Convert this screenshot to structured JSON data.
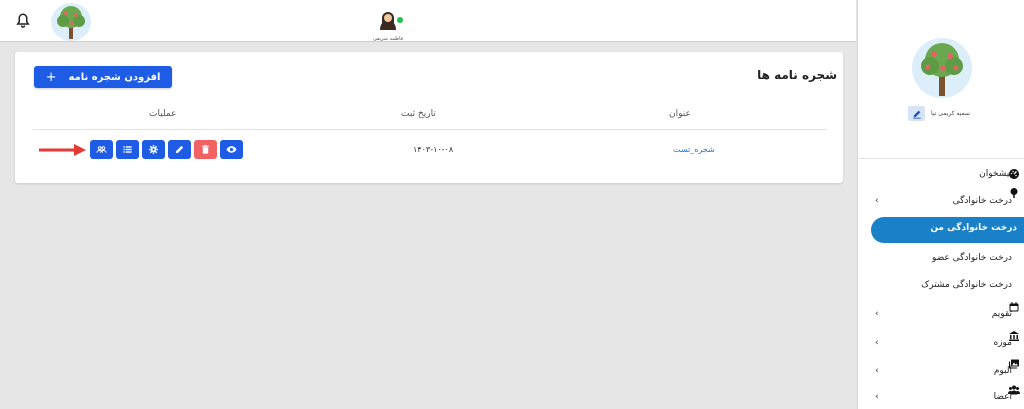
{
  "topbar": {
    "user_name": "فاطمه شریفی",
    "bell_icon": "bell-icon",
    "logo_icon": "family-tree-logo"
  },
  "card": {
    "title": "شجره نامه ها",
    "add_button_label": "افزودن شجره نامه",
    "add_button_icon": "+",
    "columns": [
      "عنوان",
      "تاریخ ثبت",
      "عملیات"
    ],
    "rows": [
      {
        "title": "شجره_تست",
        "date": "۱۴۰۳-۱۰-۰۸"
      }
    ],
    "actions": [
      "members-icon",
      "list-icon",
      "settings-icon",
      "edit-icon",
      "delete-icon",
      "view-icon"
    ]
  },
  "sidebar": {
    "user_name": "سمیه کریمی نیا",
    "menu": [
      {
        "label": "پیشخوان",
        "icon": "dashboard-icon",
        "chevron": false,
        "active": false
      },
      {
        "label": "درخت خانوادگی",
        "icon": "tree-icon",
        "chevron": true,
        "active": false
      },
      {
        "label": "درخت خانوادگی من",
        "icon": "",
        "chevron": false,
        "active": true
      },
      {
        "label": "درخت خانوادگی عضو",
        "icon": "",
        "chevron": false,
        "active": false
      },
      {
        "label": "درخت خانوادگی مشترک",
        "icon": "",
        "chevron": false,
        "active": false
      },
      {
        "label": "تقویم",
        "icon": "calendar-icon",
        "chevron": true,
        "active": false
      },
      {
        "label": "موزه",
        "icon": "museum-icon",
        "chevron": true,
        "active": false
      },
      {
        "label": "آلبوم",
        "icon": "album-icon",
        "chevron": true,
        "active": false
      },
      {
        "label": "اعضا",
        "icon": "members-icon",
        "chevron": true,
        "active": false
      }
    ]
  },
  "colors": {
    "primary": "#1f5ce6",
    "danger": "#f26262",
    "active_menu": "#1a80c8",
    "link": "#1f77d4",
    "arrow": "#e53935",
    "online": "#1fc24a"
  }
}
